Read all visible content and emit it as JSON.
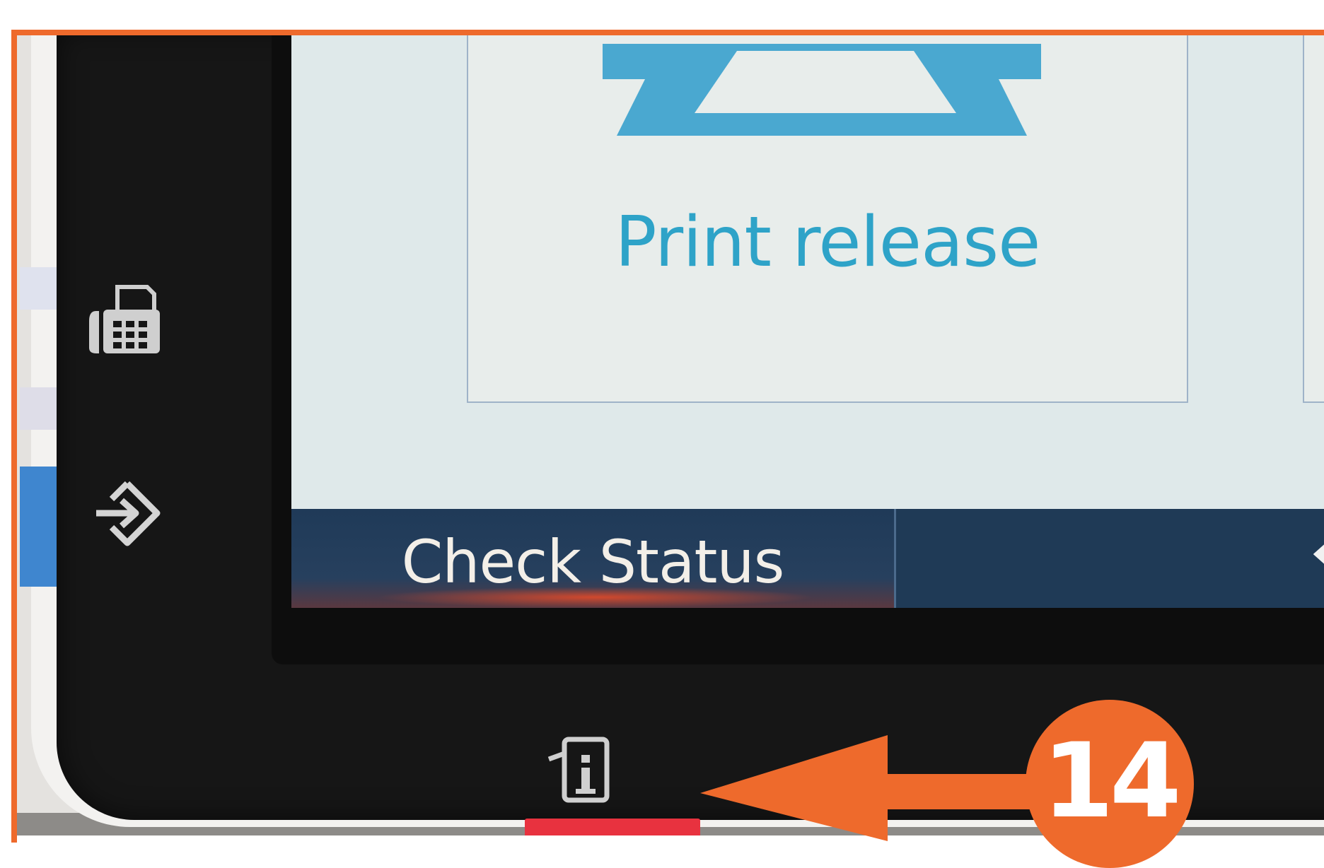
{
  "screen": {
    "tile_print_release": {
      "label": "Print release",
      "icon": "printer-icon"
    },
    "status_bar": {
      "check_status_label": "Check Status",
      "back_icon": "back-arrow-icon"
    }
  },
  "side_buttons": [
    {
      "icon": "fax-icon"
    },
    {
      "icon": "login-icon"
    }
  ],
  "bottom_button": {
    "icon": "info-icon"
  },
  "callout": {
    "number": "14"
  },
  "colors": {
    "accent_orange": "#ee6a2c",
    "screen_teal": "#2ea3c8",
    "status_bar_navy": "#1f3a56",
    "hardware_red": "#e8323f"
  }
}
